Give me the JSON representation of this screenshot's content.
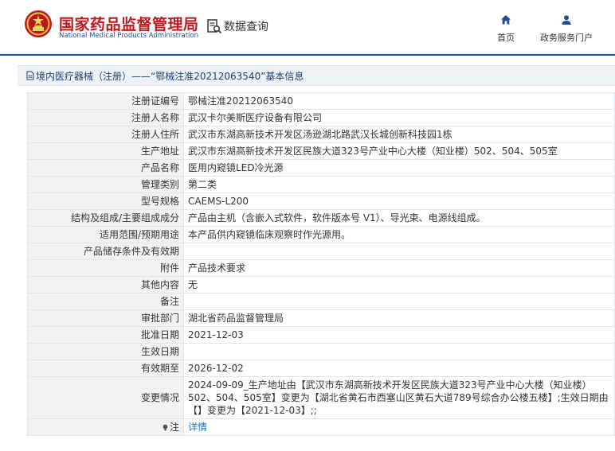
{
  "header": {
    "brand_cn": "国家药品监督管理局",
    "brand_en": "National Medical Products Administration",
    "query_label": "数据查询",
    "nav": {
      "home": "首页",
      "service": "政务服务门户"
    }
  },
  "breadcrumb": {
    "text": "境内医疗器械（注册）——“鄂械注准20212063540”基本信息"
  },
  "record": {
    "rows": [
      {
        "label": "注册证编号",
        "value": "鄂械注准20212063540"
      },
      {
        "label": "注册人名称",
        "value": "武汉卡尔美斯医疗设备有限公司"
      },
      {
        "label": "注册人住所",
        "value": "武汉市东湖高新技术开发区汤逊湖北路武汉长城创新科技园1栋"
      },
      {
        "label": "生产地址",
        "value": "武汉市东湖高新技术开发区民族大道323号产业中心大楼（知业楼）502、504、505室"
      },
      {
        "label": "产品名称",
        "value": "医用内窥镜LED冷光源"
      },
      {
        "label": "管理类别",
        "value": "第二类"
      },
      {
        "label": "型号规格",
        "value": "CAEMS-L200"
      },
      {
        "label": "结构及组成/主要组成成分",
        "value": "产品由主机（含嵌入式软件，软件版本号 V1）、导光束、电源线组成。"
      },
      {
        "label": "适用范围/预期用途",
        "value": "本产品供内窥镜临床观察时作光源用。"
      },
      {
        "label": "产品储存条件及有效期",
        "value": ""
      },
      {
        "label": "附件",
        "value": "产品技术要求"
      },
      {
        "label": "其他内容",
        "value": "无"
      },
      {
        "label": "备注",
        "value": ""
      },
      {
        "label": "审批部门",
        "value": "湖北省药品监督管理局"
      },
      {
        "label": "批准日期",
        "value": "2021-12-03"
      },
      {
        "label": "生效日期",
        "value": ""
      },
      {
        "label": "有效期至",
        "value": "2026-12-02"
      },
      {
        "label": "变更情况",
        "value": "2024-09-09_生产地址由【武汉市东湖高新技术开发区民族大道323号产业中心大楼（知业楼）502、504、505室】变更为【湖北省黄石市西塞山区黄石大道789号综合办公楼五楼】;生效日期由【】变更为【2021-12-03】;;"
      }
    ],
    "note_label": "注",
    "note_link": "详情"
  },
  "colors": {
    "brand_red": "#c0161e",
    "brand_blue": "#1d4f91",
    "link_blue": "#1d6fb8",
    "label_bg": "#f2f2f2"
  },
  "icons": {
    "emblem": "national-emblem-icon",
    "query": "search-document-icon",
    "home": "home-icon",
    "service": "user-icon",
    "crumb": "document-icon",
    "note": "bulb-icon"
  }
}
